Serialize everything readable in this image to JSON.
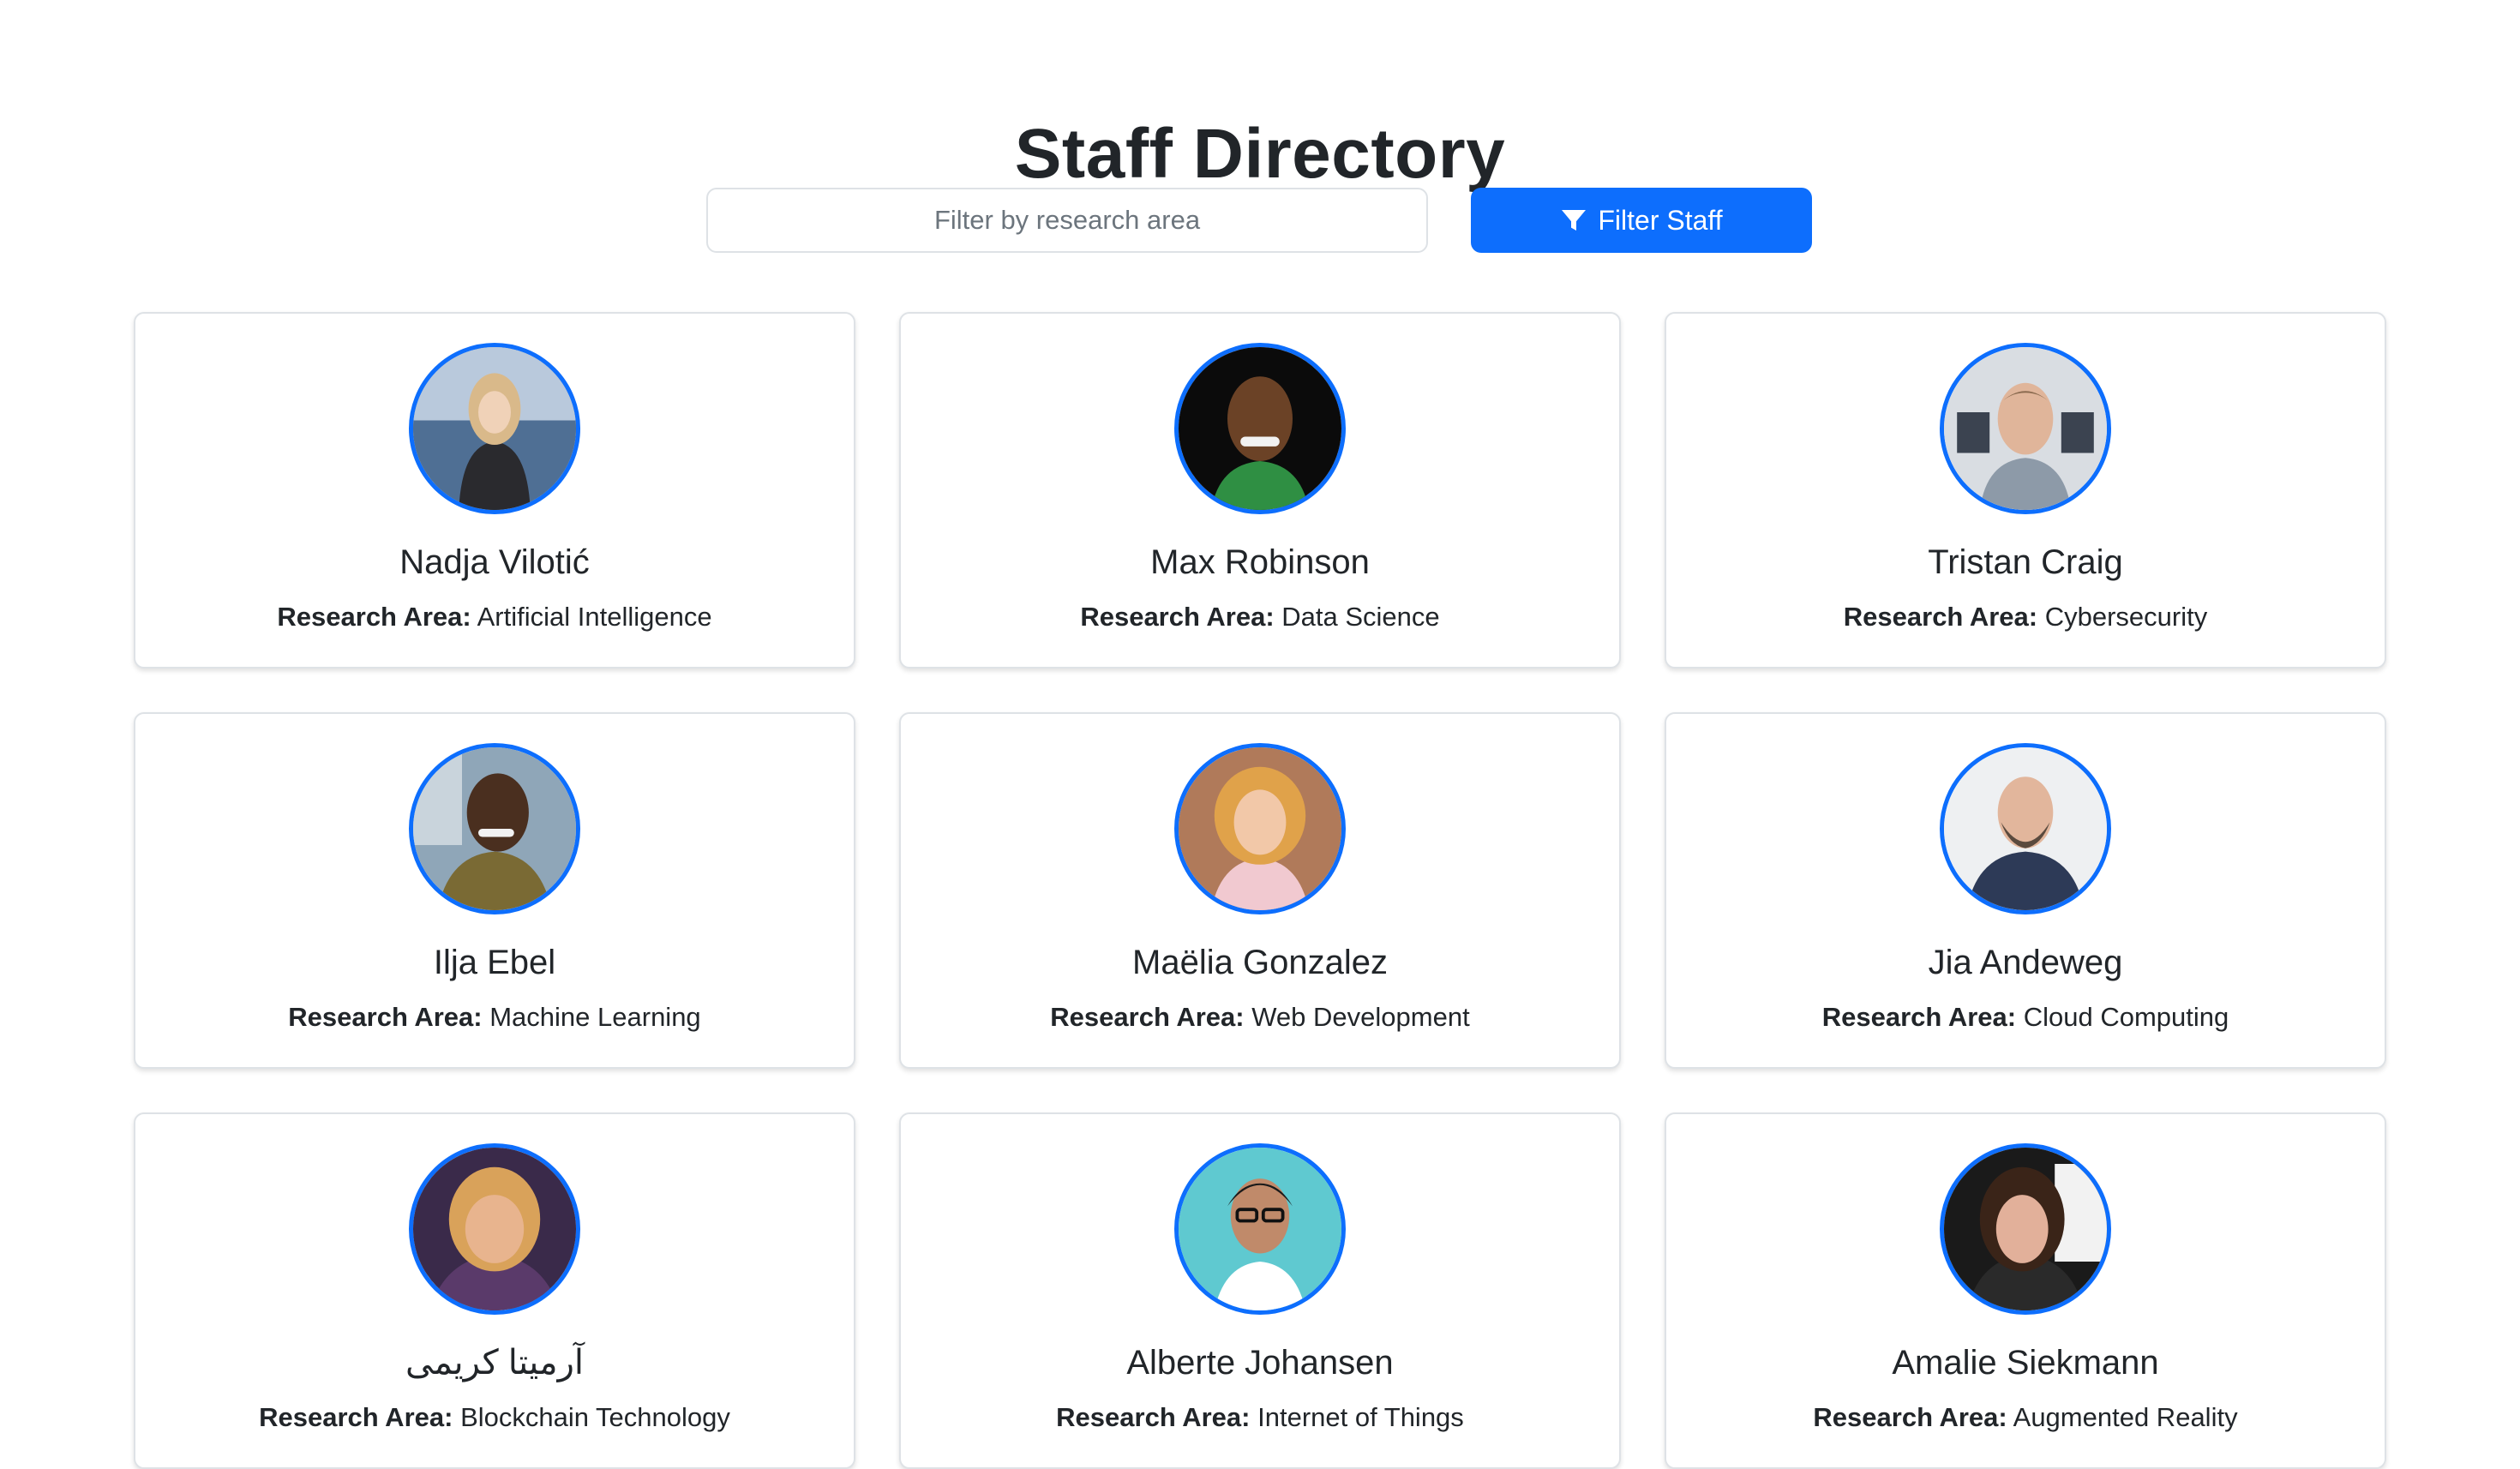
{
  "header": {
    "title": "Staff Directory"
  },
  "filter": {
    "placeholder": "Filter by research area",
    "value": "",
    "button_label": "Filter Staff",
    "button_icon": "filter-icon"
  },
  "colors": {
    "accent": "#0d6efd",
    "card_border": "#dee2e6",
    "text": "#212529",
    "placeholder": "#6c757d"
  },
  "staff": [
    {
      "name": "Nadja Vilotić",
      "area_label": "Research Area:",
      "area": "Artificial Intelligence",
      "photo": "avatar-photo"
    },
    {
      "name": "Max Robinson",
      "area_label": "Research Area:",
      "area": "Data Science",
      "photo": "avatar-photo"
    },
    {
      "name": "Tristan Craig",
      "area_label": "Research Area:",
      "area": "Cybersecurity",
      "photo": "avatar-photo"
    },
    {
      "name": "Ilja Ebel",
      "area_label": "Research Area:",
      "area": "Machine Learning",
      "photo": "avatar-photo"
    },
    {
      "name": "Maëlia Gonzalez",
      "area_label": "Research Area:",
      "area": "Web Development",
      "photo": "avatar-photo"
    },
    {
      "name": "Jia Andeweg",
      "area_label": "Research Area:",
      "area": "Cloud Computing",
      "photo": "avatar-photo"
    },
    {
      "name": "آرمیتا کریمی",
      "area_label": "Research Area:",
      "area": "Blockchain Technology",
      "photo": "avatar-photo"
    },
    {
      "name": "Alberte Johansen",
      "area_label": "Research Area:",
      "area": "Internet of Things",
      "photo": "avatar-photo"
    },
    {
      "name": "Amalie Siekmann",
      "area_label": "Research Area:",
      "area": "Augmented Reality",
      "photo": "avatar-photo"
    }
  ]
}
